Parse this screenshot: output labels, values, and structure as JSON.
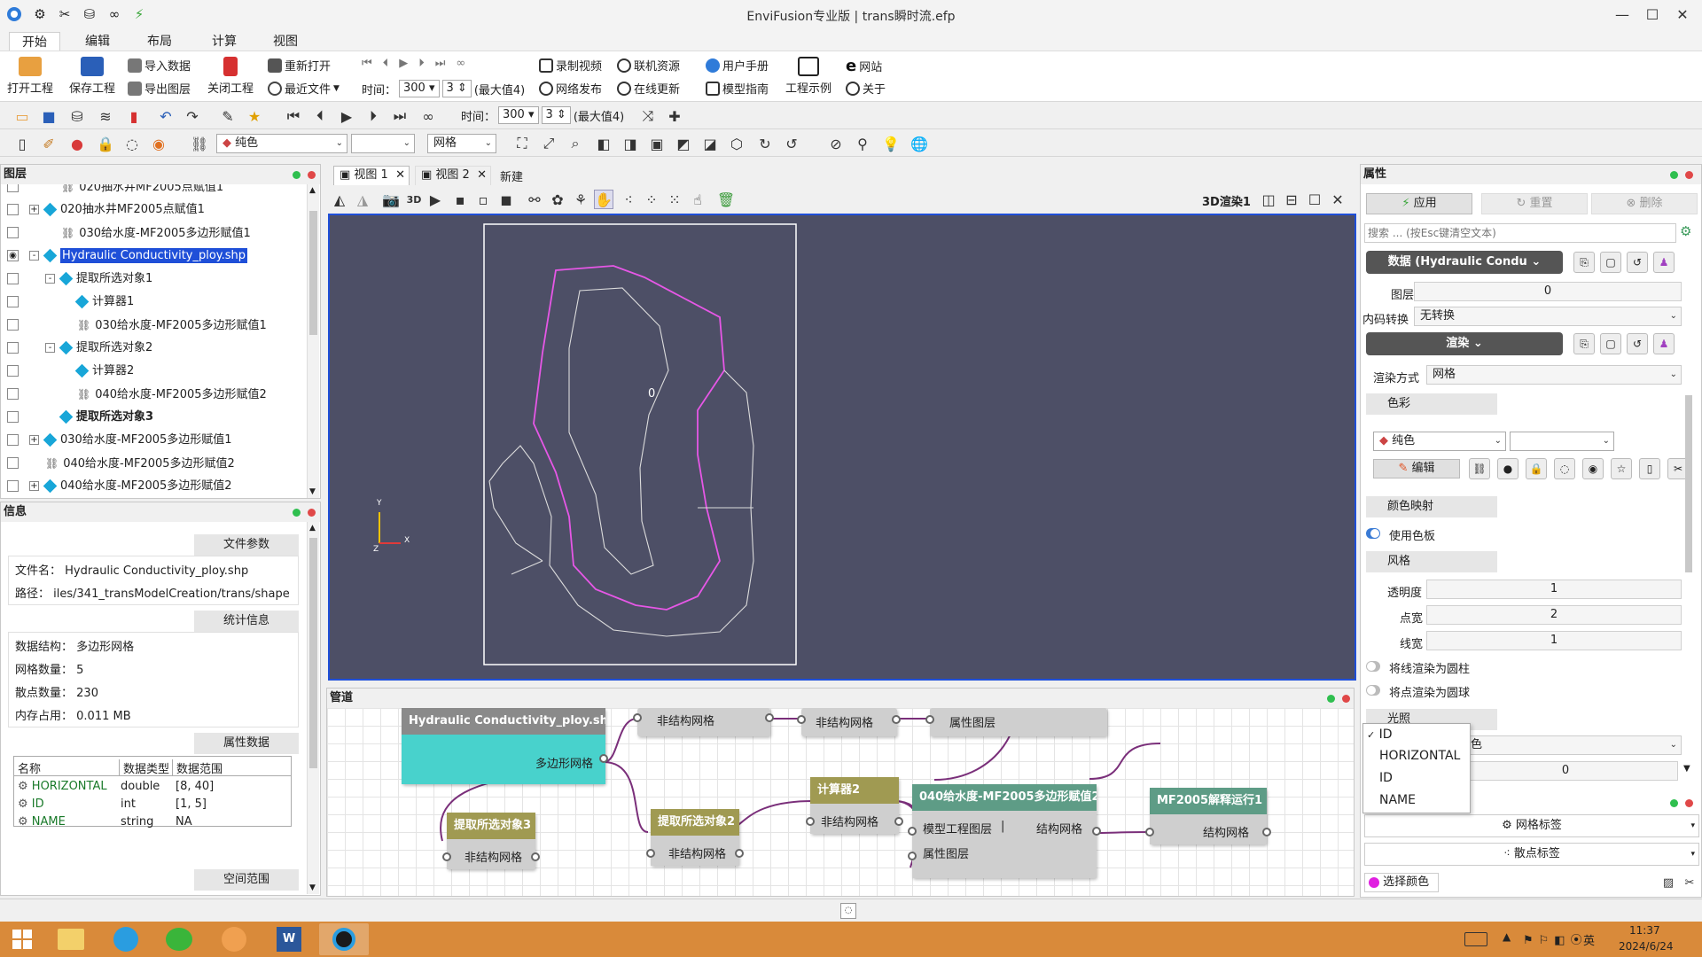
{
  "window": {
    "title": "EnviFusion专业版 | trans瞬时流.efp"
  },
  "colors": {
    "accent": "#1f4fd8",
    "brand_blue": "#2f7bd9",
    "graph_bg": "#4d4f66",
    "node_teal": "#48d2cc",
    "node_gold": "#a09a52",
    "node_green": "#5e9c86",
    "node_gray": "#8a8a8a",
    "taskbar": "#d98a3a",
    "boundary_pink": "#e657e6"
  },
  "menu_tabs": [
    "开始",
    "编辑",
    "布局",
    "计算",
    "视图"
  ],
  "ribbon": {
    "open_project": "打开工程",
    "save_project": "保存工程",
    "import_data": "导入数据",
    "export_layer": "导出图层",
    "close_project": "关闭工程",
    "reopen": "重新打开",
    "recent_files": "最近文件",
    "time_label": "时间：",
    "time_value": "300",
    "step_value": "3",
    "max_label": "(最大值4)",
    "record_video": "录制视频",
    "network_publish": "网络发布",
    "online_resources": "联机资源",
    "online_update": "在线更新",
    "user_manual": "用户手册",
    "model_guide": "模型指南",
    "project_examples": "工程示例",
    "website": "网站",
    "about": "关于"
  },
  "toolbar2": {
    "time_label": "时间：",
    "time_value": "300",
    "step_value": "3",
    "max_label": "(最大值4)"
  },
  "toolbar3": {
    "color_mode": "纯色",
    "mesh_mode": "网格"
  },
  "layers_panel": {
    "title": "图层",
    "items": [
      {
        "label": "020抽水井MF2005点赋值1",
        "level": 1,
        "icon": "link-icon"
      },
      {
        "label": "020抽水井MF2005点赋值1",
        "level": 0,
        "icon": "cube-icon",
        "expander": "+"
      },
      {
        "label": "030给水度-MF2005多边形赋值1",
        "level": 1,
        "icon": "link-icon"
      },
      {
        "label": "Hydraulic Conductivity_ploy.shp",
        "level": 0,
        "icon": "cube-icon",
        "expander": "-",
        "selected": true,
        "visible": true
      },
      {
        "label": "提取所选对象1",
        "level": 1,
        "icon": "cube-icon",
        "expander": "-"
      },
      {
        "label": "计算器1",
        "level": 2,
        "icon": "cube-icon"
      },
      {
        "label": "030给水度-MF2005多边形赋值1",
        "level": 2,
        "icon": "link-icon"
      },
      {
        "label": "提取所选对象2",
        "level": 1,
        "icon": "cube-icon",
        "expander": "-"
      },
      {
        "label": "计算器2",
        "level": 2,
        "icon": "cube-icon"
      },
      {
        "label": "040给水度-MF2005多边形赋值2",
        "level": 2,
        "icon": "link-icon"
      },
      {
        "label": "提取所选对象3",
        "level": 1,
        "icon": "cube-icon",
        "bold": true
      },
      {
        "label": "030给水度-MF2005多边形赋值1",
        "level": 0,
        "icon": "cube-icon",
        "expander": "+"
      },
      {
        "label": "040给水度-MF2005多边形赋值2",
        "level": 0,
        "icon": "link-icon"
      },
      {
        "label": "040给水度-MF2005多边形赋值2",
        "level": 0,
        "icon": "cube-icon",
        "expander": "+"
      }
    ]
  },
  "info_panel": {
    "title": "信息",
    "file_params": "文件参数",
    "file_name_label": "文件名：",
    "file_name": "Hydraulic Conductivity_ploy.shp",
    "path_label": "路径：",
    "path": "iles/341_transModelCreation/trans/shape",
    "stats_title": "统计信息",
    "data_structure_label": "数据结构：",
    "data_structure": "多边形网格",
    "cell_count_label": "网格数量：",
    "cell_count": "5",
    "point_count_label": "散点数量：",
    "point_count": "230",
    "memory_label": "内存占用：",
    "memory": "0.011 MB",
    "attr_title": "属性数据",
    "attr_headers": [
      "名称",
      "数据类型",
      "数据范围"
    ],
    "attr_rows": [
      {
        "name": "HORIZONTAL",
        "type": "double",
        "range": "[8, 40]"
      },
      {
        "name": "ID",
        "type": "int",
        "range": "[1, 5]"
      },
      {
        "name": "NAME",
        "type": "string",
        "range": "NA"
      }
    ],
    "spatial_title": "空间范围"
  },
  "view_tabs": {
    "tab1": "视图 1",
    "tab2": "视图 2",
    "new": "新建"
  },
  "view_toolbar": {
    "render_mode": "3D渲染1"
  },
  "viewport": {
    "label": "0",
    "axis_x": "X",
    "axis_y": "Y",
    "axis_z": "Z"
  },
  "pipeline": {
    "title": "管道",
    "nodes": {
      "hc": {
        "title": "Hydraulic Conductivity_ploy.shp",
        "port": "多边形网格"
      },
      "u1": {
        "label": "非结构网格"
      },
      "u2": {
        "label": "非结构网格"
      },
      "attr": {
        "label": "属性图层"
      },
      "ex3": {
        "title": "提取所选对象3",
        "port": "非结构网格"
      },
      "ex2": {
        "title": "提取所选对象2",
        "port": "非结构网格"
      },
      "calc2": {
        "title": "计算器2",
        "port": "非结构网格"
      },
      "n040": {
        "title": "040给水度-MF2005多边形赋值2",
        "in1": "模型工程图层",
        "sep": "|",
        "in2": "属性图层",
        "out": "结构网格"
      },
      "mf": {
        "title": "MF2005解释运行1",
        "port": "结构网格"
      }
    }
  },
  "properties": {
    "title": "属性",
    "apply": "应用",
    "reset": "重置",
    "delete": "删除",
    "search_placeholder": "搜索 ... (按Esc键清空文本)",
    "data_group": "数据 (Hydraulic Condu",
    "layer_no_label": "图层号",
    "layer_no": "0",
    "encoding_label": "内码转换",
    "encoding": "无转换",
    "render_group": "渲染",
    "render_mode_label": "渲染方式",
    "render_mode": "网格",
    "color_section": "色彩",
    "solid_color": "纯色",
    "edit": "编辑",
    "colormap_section": "颜色映射",
    "use_palette": "使用色板",
    "style_section": "风格",
    "opacity_label": "透明度",
    "opacity": "1",
    "point_width_label": "点宽",
    "point_width": "2",
    "line_width_label": "线宽",
    "line_width": "1",
    "render_lines_tubes": "将线渲染为圆柱",
    "render_points_spheres": "将点渲染为圆球",
    "label_section": "光照",
    "label_combo_tail": "颜色",
    "label_value": "0",
    "mesh_label": "网格标签",
    "point_label": "散点标签",
    "select_color": "选择颜色",
    "dropdown_items": [
      "ID",
      "HORIZONTAL",
      "ID",
      "NAME"
    ],
    "dropdown_selected": "ID"
  },
  "taskbar": {
    "time": "11:37",
    "date": "2024/6/24",
    "lang": "英"
  }
}
